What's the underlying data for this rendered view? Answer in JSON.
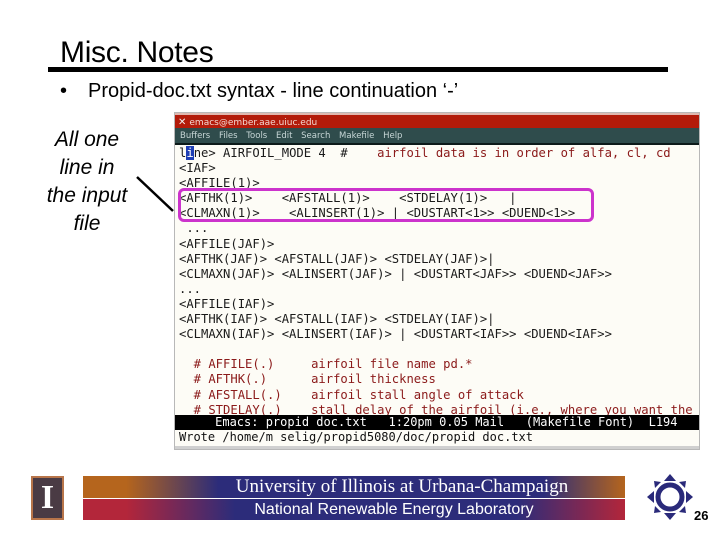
{
  "slide": {
    "title": "Misc. Notes",
    "bullet": "Propid-doc.txt syntax - line continuation ‘-’",
    "side_note": [
      "All one",
      "line in",
      "the input",
      "file"
    ],
    "page_number": "26"
  },
  "emacs": {
    "window_title": "emacs@ember.aae.uiuc.edu",
    "menu": [
      "Buffers",
      "Files",
      "Tools",
      "Edit",
      "Search",
      "Makefile",
      "Help"
    ],
    "lines": [
      {
        "code": "line> AIRFOIL_MODE 4  #",
        "comment": "    airfoil data is in order of alfa, cl, cd"
      },
      {
        "code": "<IAF>",
        "comment": ""
      },
      {
        "code": "<AFFILE(1)>",
        "comment": ""
      },
      {
        "code": "<AFTHK(1)>    <AFSTALL(1)>    <STDELAY(1)>   |",
        "comment": ""
      },
      {
        "code": "<CLMAXN(1)>    <ALINSERT(1)> | <DUSTART<1>> <DUEND<1>>",
        "comment": ""
      },
      {
        "code": " ...",
        "comment": ""
      },
      {
        "code": "<AFFILE(JAF)>",
        "comment": ""
      },
      {
        "code": "<AFTHK(JAF)> <AFSTALL(JAF)> <STDELAY(JAF)>|",
        "comment": ""
      },
      {
        "code": "<CLMAXN(JAF)> <ALINSERT(JAF)> | <DUSTART<JAF>> <DUEND<JAF>>",
        "comment": ""
      },
      {
        "code": "...",
        "comment": ""
      },
      {
        "code": "<AFFILE(IAF)>",
        "comment": ""
      },
      {
        "code": "<AFTHK(IAF)> <AFSTALL(IAF)> <STDELAY(IAF)>|",
        "comment": ""
      },
      {
        "code": "<CLMAXN(IAF)> <ALINSERT(IAF)> | <DUSTART<IAF>> <DUEND<IAF>>",
        "comment": ""
      },
      {
        "code": "",
        "comment": ""
      },
      {
        "code": "",
        "comment": "  # AFFILE(.)     airfoil file name pd.*"
      },
      {
        "code": "",
        "comment": "  # AFTHK(.)      airfoil thickness"
      },
      {
        "code": "",
        "comment": "  # AFSTALL(.)    airfoil stall angle of attack"
      },
      {
        "code": "",
        "comment": "  # STDELAY(.)    stall delay of the airfoil (i.e., where you want the"
      }
    ],
    "modeline": "     Emacs: propid doc.txt   1:20pm 0.05 Mail   (Makefile Font)  L194",
    "minibuffer": "Wrote /home/m selig/propid5080/doc/propid doc.txt"
  },
  "footer": {
    "logo_letter": "I",
    "university": "University of Illinois at Urbana-Champaign",
    "lab": "National Renewable Energy Laboratory"
  },
  "colors": {
    "titlebar": "#b31b0a",
    "menubar": "#2f4c4c",
    "highlight": "#cc33cc",
    "comment": "#8b1a1a",
    "banner_blue": "#2c2c7a"
  }
}
